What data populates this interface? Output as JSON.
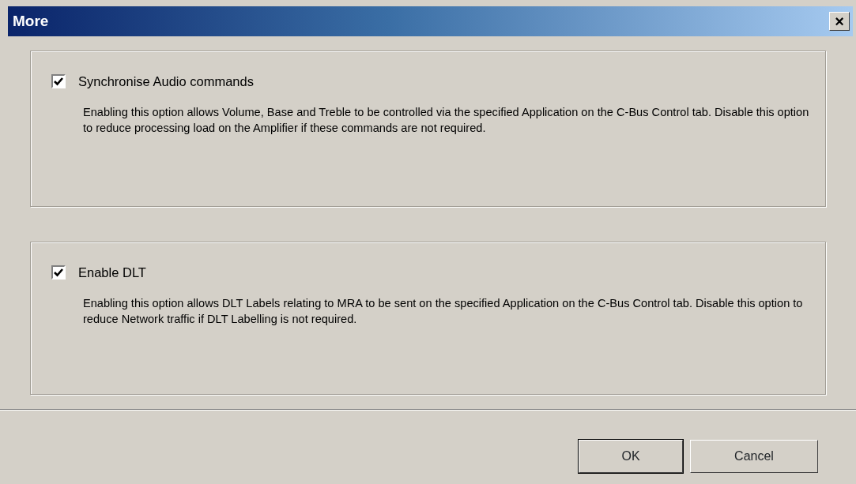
{
  "window": {
    "title": "More",
    "close": "×"
  },
  "options": [
    {
      "label": "Synchronise Audio commands",
      "checked": true,
      "description": "Enabling this option allows Volume, Base and Treble to be controlled via the specified Application on the C-Bus Control tab. Disable this option to reduce processing load on the Amplifier if these commands are not required."
    },
    {
      "label": "Enable DLT",
      "checked": true,
      "description": "Enabling this option allows DLT Labels relating to MRA to be sent on the specified Application on the C-Bus Control tab. Disable this option to reduce Network traffic if DLT Labelling is not required."
    }
  ],
  "buttons": [
    {
      "label": "OK",
      "default": true
    },
    {
      "label": "Cancel",
      "default": false
    }
  ]
}
